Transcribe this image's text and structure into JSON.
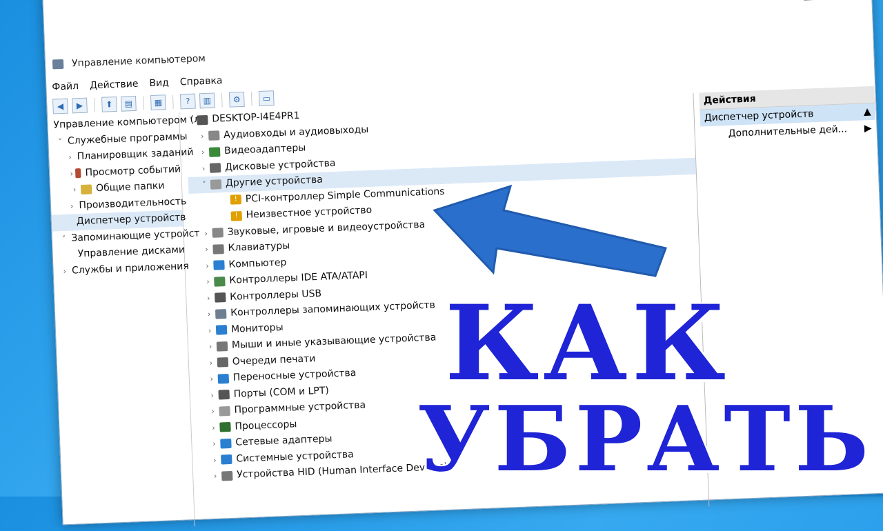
{
  "window": {
    "title": "Управление компьютером",
    "controls": {
      "minimize": "—",
      "maximize": "☐",
      "close": "✕"
    },
    "menu": [
      "Файл",
      "Действие",
      "Вид",
      "Справка"
    ]
  },
  "left_tree": [
    {
      "label": "Управление компьютером (л",
      "indent": 0,
      "arrow": "",
      "icon_color": "#6a7f99"
    },
    {
      "label": "Служебные программы",
      "indent": 1,
      "arrow": "˅",
      "icon_color": "#a77b2f"
    },
    {
      "label": "Планировщик заданий",
      "indent": 2,
      "arrow": "›",
      "icon_color": "#d9a13a"
    },
    {
      "label": "Просмотр событий",
      "indent": 2,
      "arrow": "›",
      "icon_color": "#b34b32"
    },
    {
      "label": "Общие папки",
      "indent": 2,
      "arrow": "›",
      "icon_color": "#d6b23a"
    },
    {
      "label": "Производительность",
      "indent": 2,
      "arrow": "›",
      "icon_color": "#b02222"
    },
    {
      "label": "Диспетчер устройств",
      "indent": 2,
      "arrow": "",
      "icon_color": "#555555",
      "selected": true
    },
    {
      "label": "Запоминающие устройст",
      "indent": 1,
      "arrow": "˅",
      "icon_color": "#7a8a9a"
    },
    {
      "label": "Управление дисками",
      "indent": 2,
      "arrow": "",
      "icon_color": "#555555"
    },
    {
      "label": "Службы и приложения",
      "indent": 1,
      "arrow": "›",
      "icon_color": "#6f7f8f"
    }
  ],
  "device_tree": {
    "root": "DESKTOP-I4E4PR1",
    "items": [
      {
        "label": "Аудиовходы и аудиовыходы",
        "arrow": "›",
        "sub": false,
        "icon_color": "#888888"
      },
      {
        "label": "Видеоадаптеры",
        "arrow": "›",
        "sub": false,
        "icon_color": "#3a8a3a"
      },
      {
        "label": "Дисковые устройства",
        "arrow": "›",
        "sub": false,
        "icon_color": "#666666"
      },
      {
        "label": "Другие устройства",
        "arrow": "˅",
        "sub": false,
        "icon_color": "#999999",
        "selected": true
      },
      {
        "label": "PCI-контроллер Simple Communications",
        "arrow": "",
        "sub": true,
        "icon_color": "#e0a000"
      },
      {
        "label": "Неизвестное устройство",
        "arrow": "",
        "sub": true,
        "icon_color": "#e0a000"
      },
      {
        "label": "Звуковые, игровые и видеоустройства",
        "arrow": "›",
        "sub": false,
        "icon_color": "#888888"
      },
      {
        "label": "Клавиатуры",
        "arrow": "›",
        "sub": false,
        "icon_color": "#777777"
      },
      {
        "label": "Компьютер",
        "arrow": "›",
        "sub": false,
        "icon_color": "#2a7fd0"
      },
      {
        "label": "Контроллеры IDE ATA/ATAPI",
        "arrow": "›",
        "sub": false,
        "icon_color": "#4a8a4a"
      },
      {
        "label": "Контроллеры USB",
        "arrow": "›",
        "sub": false,
        "icon_color": "#555555"
      },
      {
        "label": "Контроллеры запоминающих устройств",
        "arrow": "›",
        "sub": false,
        "icon_color": "#6f7f8f"
      },
      {
        "label": "Мониторы",
        "arrow": "›",
        "sub": false,
        "icon_color": "#2a7fd0"
      },
      {
        "label": "Мыши и иные указывающие устройства",
        "arrow": "›",
        "sub": false,
        "icon_color": "#777777"
      },
      {
        "label": "Очереди печати",
        "arrow": "›",
        "sub": false,
        "icon_color": "#666666"
      },
      {
        "label": "Переносные устройства",
        "arrow": "›",
        "sub": false,
        "icon_color": "#2a7fd0"
      },
      {
        "label": "Порты (COM и LPT)",
        "arrow": "›",
        "sub": false,
        "icon_color": "#555555"
      },
      {
        "label": "Программные устройства",
        "arrow": "›",
        "sub": false,
        "icon_color": "#999999"
      },
      {
        "label": "Процессоры",
        "arrow": "›",
        "sub": false,
        "icon_color": "#2f6f2f"
      },
      {
        "label": "Сетевые адаптеры",
        "arrow": "›",
        "sub": false,
        "icon_color": "#2a7fd0"
      },
      {
        "label": "Системные устройства",
        "arrow": "›",
        "sub": false,
        "icon_color": "#2a7fd0"
      },
      {
        "label": "Устройства HID (Human Interface Devices)",
        "arrow": "›",
        "sub": false,
        "icon_color": "#777777"
      }
    ]
  },
  "actions": {
    "header": "Действия",
    "section": "Диспетчер устройств",
    "more": "Дополнительные дей..."
  },
  "overlay": {
    "line1": "КАК",
    "line2": "УБРАТЬ",
    "color": "#1f24d6"
  }
}
